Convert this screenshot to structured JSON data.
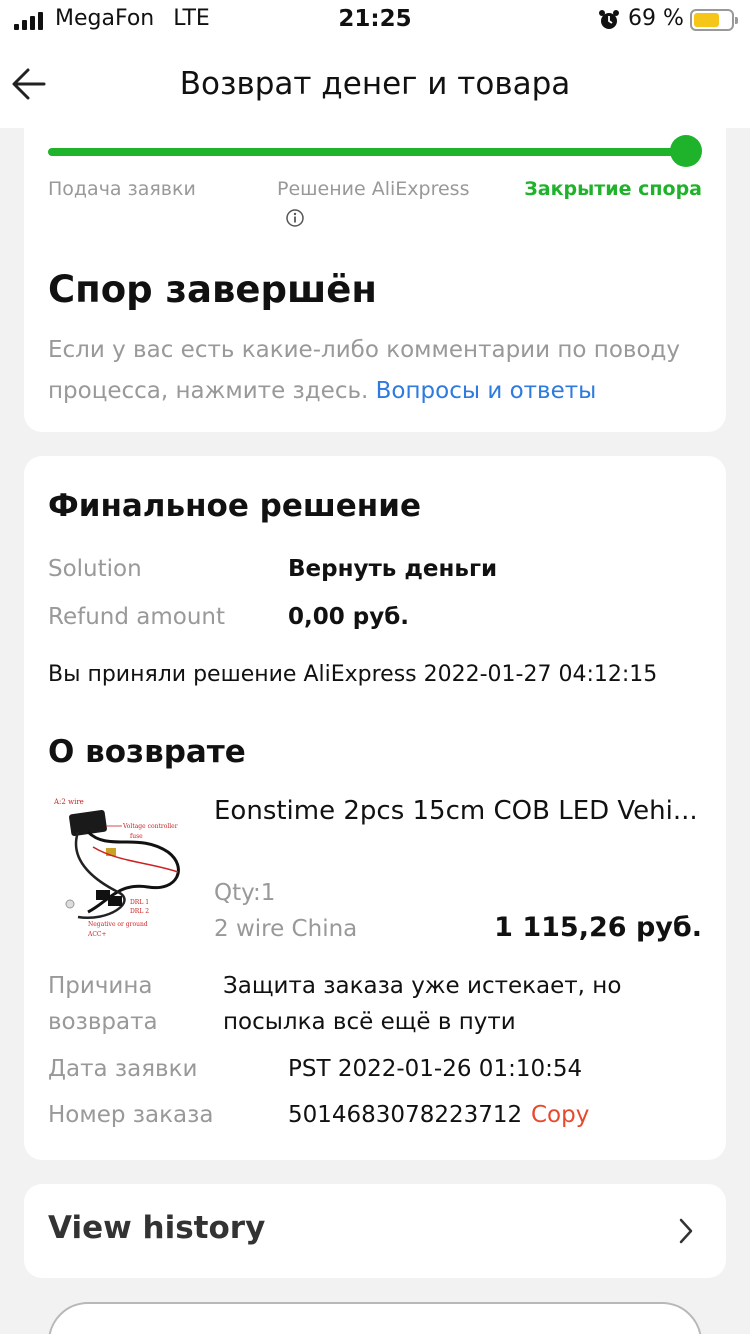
{
  "status_bar": {
    "carrier": "MegaFon",
    "network": "LTE",
    "time": "21:25",
    "battery_percent": "69 %",
    "battery_level": 0.69,
    "alarm_icon": "alarm-clock-icon"
  },
  "nav": {
    "back_icon": "arrow-left-icon",
    "title": "Возврат денег и товара"
  },
  "progress": {
    "steps": [
      "Подача заявки",
      "Решение AliExpress",
      "Закрытие спора"
    ],
    "current_step": 3,
    "info_icon": "info-circle-icon",
    "accent_color": "#1fb22b"
  },
  "dispute": {
    "heading": "Спор завершён",
    "description": "Если у вас есть какие-либо комментарии по поводу процесса, нажмите здесь.",
    "faq_link": "Вопросы и ответы"
  },
  "final_decision": {
    "heading": "Финальное решение",
    "solution_label": "Solution",
    "solution_value": "Вернуть деньги",
    "refund_label": "Refund amount",
    "refund_value": "0,00 руб.",
    "accepted_note": "Вы приняли решение AliExpress 2022-01-27 04:12:15"
  },
  "return_info": {
    "heading": "О возврате",
    "product": {
      "title": "Eonstime 2pcs 15cm COB LED Vehi...",
      "qty": "Qty:1",
      "variant": "2 wire China",
      "price": "1 115,26 руб."
    },
    "reason_label": "Причина возврата",
    "reason_value": "Защита заказа уже истекает, но посылка всё ещё в пути",
    "date_label": "Дата заявки",
    "date_value": "PST 2022-01-26 01:10:54",
    "order_label": "Номер заказа",
    "order_value": "5014683078223712",
    "copy_label": "Copy"
  },
  "history": {
    "label": "View history",
    "chevron_icon": "chevron-right-icon"
  }
}
